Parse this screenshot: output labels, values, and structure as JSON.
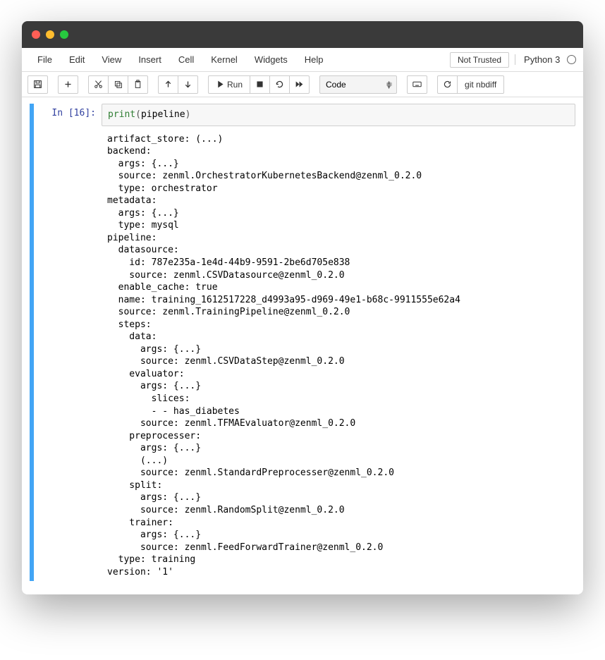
{
  "menus": {
    "file": "File",
    "edit": "Edit",
    "view": "View",
    "insert": "Insert",
    "cell": "Cell",
    "kernel": "Kernel",
    "widgets": "Widgets",
    "help": "Help"
  },
  "header": {
    "not_trusted": "Not Trusted",
    "kernel": "Python 3"
  },
  "toolbar": {
    "run_label": "Run",
    "celltype": "Code",
    "nbdiff": "git nbdiff"
  },
  "cell": {
    "prompt": "In [16]:",
    "code": {
      "fn": "print",
      "open": "(",
      "arg": "pipeline",
      "close": ")"
    },
    "output": "artifact_store: (...)\nbackend:\n  args: {...}\n  source: zenml.OrchestratorKubernetesBackend@zenml_0.2.0\n  type: orchestrator\nmetadata:\n  args: {...}\n  type: mysql\npipeline:\n  datasource:\n    id: 787e235a-1e4d-44b9-9591-2be6d705e838\n    source: zenml.CSVDatasource@zenml_0.2.0\n  enable_cache: true\n  name: training_1612517228_d4993a95-d969-49e1-b68c-9911555e62a4\n  source: zenml.TrainingPipeline@zenml_0.2.0\n  steps:\n    data:\n      args: {...}\n      source: zenml.CSVDataStep@zenml_0.2.0\n    evaluator:\n      args: {...}\n        slices:\n        - - has_diabetes\n      source: zenml.TFMAEvaluator@zenml_0.2.0\n    preprocesser:\n      args: {...}\n      (...)\n      source: zenml.StandardPreprocesser@zenml_0.2.0\n    split:\n      args: {...}\n      source: zenml.RandomSplit@zenml_0.2.0\n    trainer:\n      args: {...}\n      source: zenml.FeedForwardTrainer@zenml_0.2.0\n  type: training\nversion: '1'"
  }
}
